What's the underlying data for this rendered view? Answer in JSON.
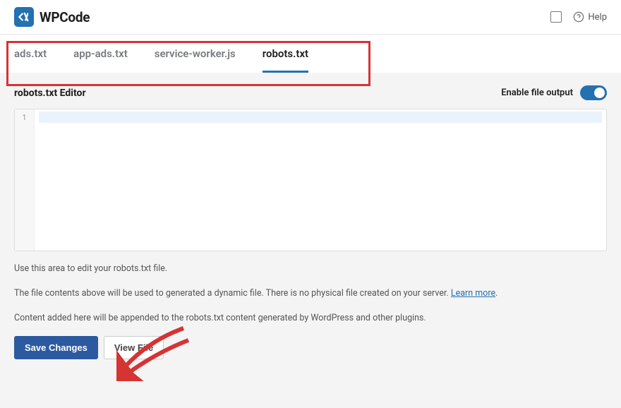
{
  "brand": {
    "name": "WPCode"
  },
  "header": {
    "help": "Help"
  },
  "tabs": {
    "items": [
      {
        "label": "ads.txt"
      },
      {
        "label": "app-ads.txt"
      },
      {
        "label": "service-worker.js"
      },
      {
        "label": "robots.txt"
      }
    ],
    "active_index": 3
  },
  "editor": {
    "title": "robots.txt Editor",
    "toggle_label": "Enable file output",
    "toggle_on": true,
    "line_number": "1",
    "content": ""
  },
  "hints": {
    "use_area": "Use this area to edit your robots.txt file.",
    "dynamic_file_pre": "The file contents above will be used to generated a dynamic file. There is no physical file created on your server. ",
    "learn_more": "Learn more",
    "dynamic_file_post": ".",
    "appended": "Content added here will be appended to the robots.txt content generated by WordPress and other plugins."
  },
  "actions": {
    "save": "Save Changes",
    "view": "View File"
  }
}
